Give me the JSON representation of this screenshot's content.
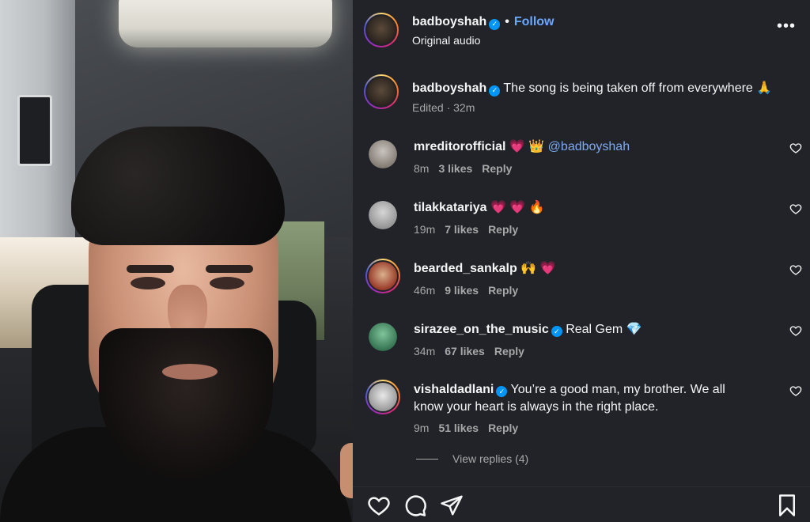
{
  "post": {
    "author": "badboyshah",
    "separator": "•",
    "follow_label": "Follow",
    "audio_label": "Original audio",
    "more_label": "•••"
  },
  "caption": {
    "username": "badboyshah",
    "text": "The song is being taken off from everywhere 🙏",
    "meta": "Edited · 32m"
  },
  "comments": [
    {
      "username": "mreditorofficial",
      "text": "💗 👑",
      "mention": "@badboyshah",
      "time": "8m",
      "likes": "3 likes",
      "reply": "Reply"
    },
    {
      "username": "tilakkatariya",
      "text": "💗 💗 🔥",
      "time": "19m",
      "likes": "7 likes",
      "reply": "Reply"
    },
    {
      "username": "bearded_sankalp",
      "text": "🙌 💗",
      "time": "46m",
      "likes": "9 likes",
      "reply": "Reply"
    },
    {
      "username": "sirazee_on_the_music",
      "text": "Real Gem 💎",
      "time": "34m",
      "likes": "67 likes",
      "reply": "Reply"
    },
    {
      "username": "vishaldadlani",
      "text": "You’re a good man, my brother. We all know your heart is always in the right place.",
      "time": "9m",
      "likes": "51 likes",
      "reply": "Reply"
    }
  ],
  "view_replies": "View replies (4)",
  "icons": {
    "like": "heart-icon",
    "comment": "comment-bubble-icon",
    "share": "send-icon",
    "save": "bookmark-icon"
  },
  "colors": {
    "panel_bg": "#212328",
    "verified": "#0095f6",
    "follow": "#6aa8ff",
    "mention": "#7eaaf0"
  }
}
